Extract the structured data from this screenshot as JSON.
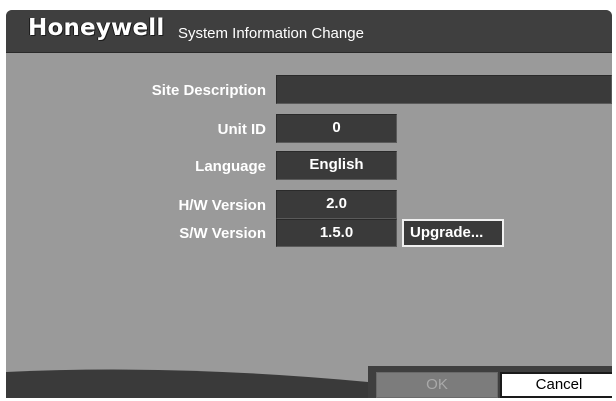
{
  "header": {
    "brand": "Honeywell",
    "title": "System Information Change"
  },
  "form": {
    "site_description": {
      "label": "Site Description",
      "value": ""
    },
    "unit_id": {
      "label": "Unit ID",
      "value": "0"
    },
    "language": {
      "label": "Language",
      "value": "English"
    },
    "hw_version": {
      "label": "H/W Version",
      "value": "2.0"
    },
    "sw_version": {
      "label": "S/W Version",
      "value": "1.5.0"
    },
    "upgrade_label": "Upgrade..."
  },
  "footer": {
    "ok_label": "OK",
    "ok_enabled": false,
    "cancel_label": "Cancel"
  },
  "colors": {
    "titlebar": "#3f3f3f",
    "panel": "#9a9a9a",
    "field": "#3a3a3a",
    "disabled_button": "#7c7c7c",
    "focused_button": "#ffffff"
  }
}
